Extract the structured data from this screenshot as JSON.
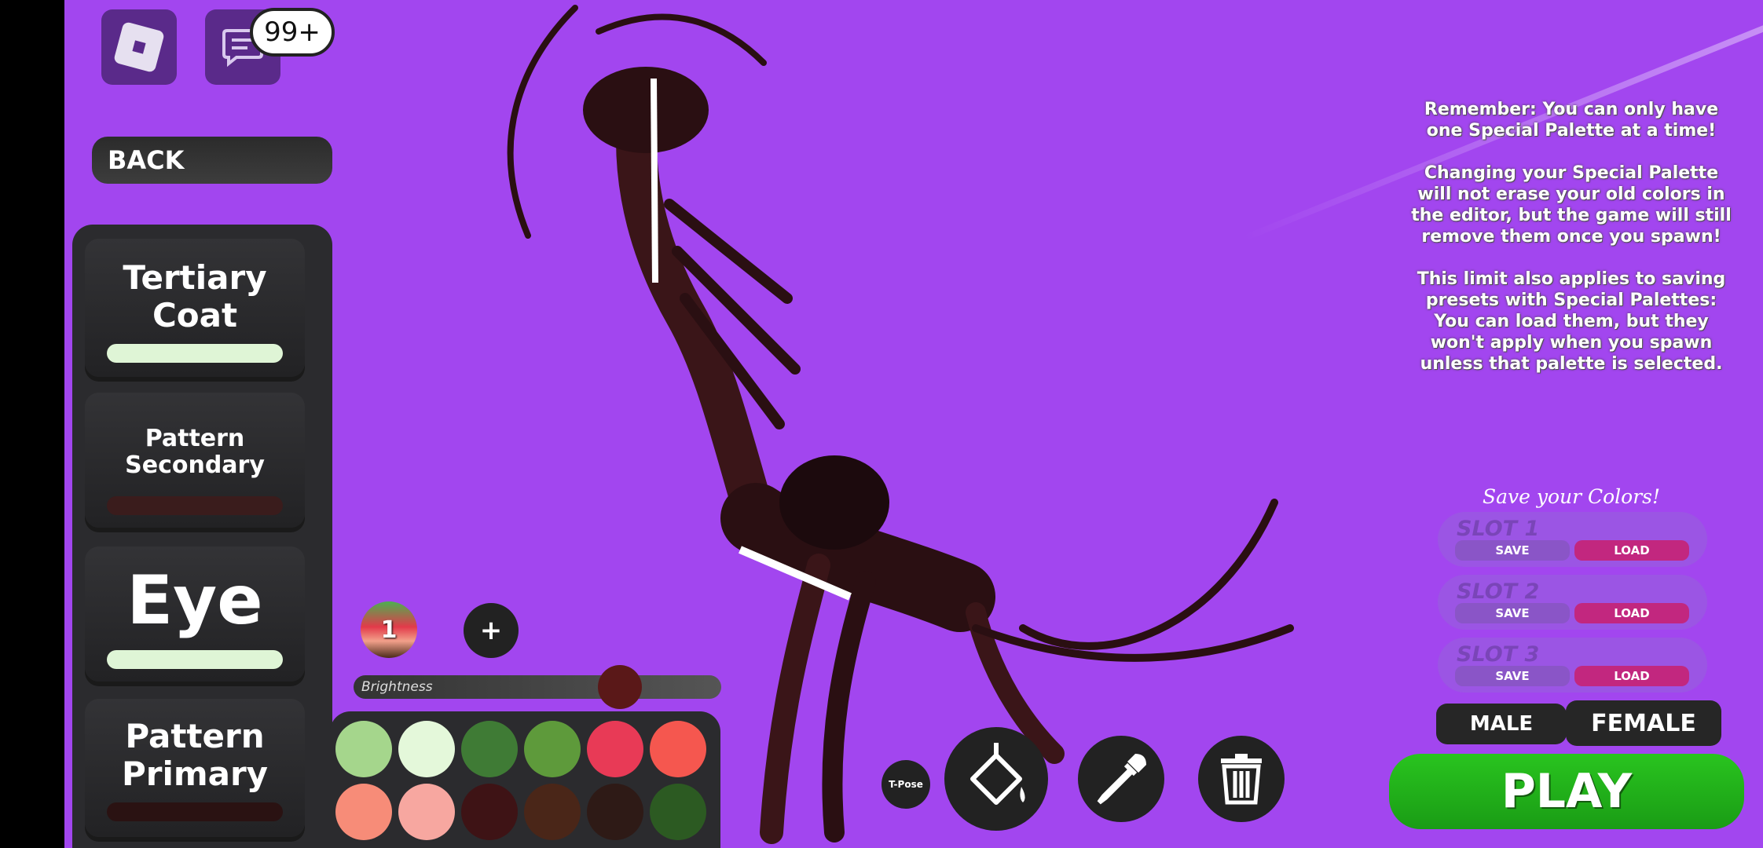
{
  "topbar": {
    "notification_count": "99+"
  },
  "nav": {
    "back_label": "BACK"
  },
  "categories": [
    {
      "label_line1": "Tertiary",
      "label_line2": "Coat",
      "color": "#dff5d6"
    },
    {
      "label_line1": "Pattern",
      "label_line2": "Secondary",
      "color": "#3a1c1c"
    },
    {
      "label_line1": "Eye",
      "label_line2": "",
      "color": "#dff5d6"
    },
    {
      "label_line1": "Pattern",
      "label_line2": "Primary",
      "color": "#2a1212"
    }
  ],
  "palette": {
    "active_number": "1",
    "add_label": "+",
    "brightness_label": "Brightness",
    "swatches": [
      "#a5d68c",
      "#e4f8da",
      "#3f7b35",
      "#5e9a3b",
      "#e83a56",
      "#f5574f",
      "#f78c78",
      "#f7a7a0",
      "#3e1315",
      "#4a2618",
      "#2e1a16",
      "#2c5a22"
    ]
  },
  "tools": {
    "tpose_label": "T-Pose"
  },
  "info": {
    "para1": "Remember: You can only have one Special Palette at a time!",
    "para2": "Changing your Special Palette will not erase your old colors in the editor, but the game will still remove them once you spawn!",
    "para3": "This limit also applies to saving presets with Special Palettes: You can load them, but they won't apply when you spawn unless that palette is selected."
  },
  "saves": {
    "title": "Save your Colors!",
    "slots": [
      {
        "name": "SLOT 1",
        "save": "SAVE",
        "load": "LOAD"
      },
      {
        "name": "SLOT 2",
        "save": "SAVE",
        "load": "LOAD"
      },
      {
        "name": "SLOT 3",
        "save": "SAVE",
        "load": "LOAD"
      }
    ]
  },
  "gender": {
    "male": "MALE",
    "female": "FEMALE"
  },
  "play_label": "PLAY"
}
